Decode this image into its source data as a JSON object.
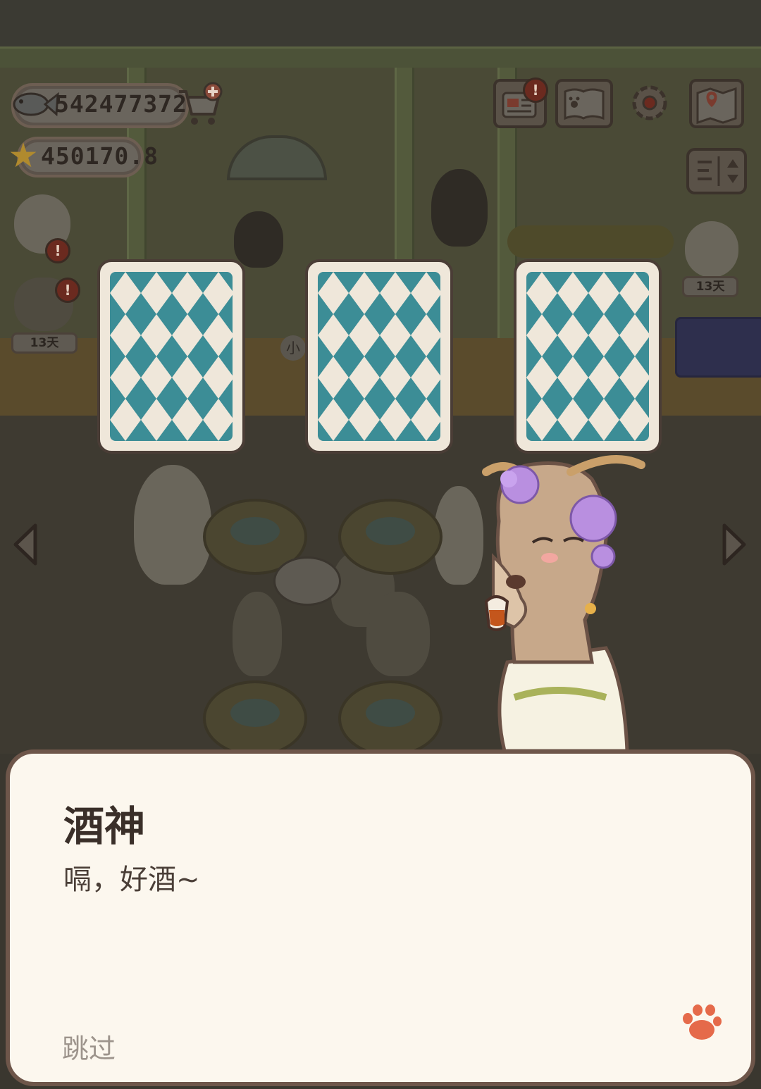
{
  "hud": {
    "fish_currency": "542477372",
    "star_currency": "450170.8",
    "add_currency_icon": "cart-plus-icon"
  },
  "top_buttons": [
    {
      "name": "mail-button",
      "icon": "card-notice-icon",
      "badge": "!"
    },
    {
      "name": "album-button",
      "icon": "paw-book-icon"
    },
    {
      "name": "settings-button",
      "icon": "gear-icon"
    },
    {
      "name": "map-button",
      "icon": "map-pin-icon"
    }
  ],
  "side": {
    "left_event_days": "13天",
    "right_event_days": "13天",
    "speech_fragment": "小"
  },
  "cards": [
    {
      "state": "face-down"
    },
    {
      "state": "face-down"
    },
    {
      "state": "face-down"
    }
  ],
  "dialog": {
    "speaker": "酒神",
    "line": "嗝，好酒~",
    "skip_label": "跳过",
    "advance_icon": "paw-icon"
  },
  "colors": {
    "card_teal": "#3c8d96",
    "card_cream": "#efe7da",
    "dialog_bg": "#fcf7ee",
    "dialog_border": "#6e564a",
    "paw_orange": "#e56a4a"
  }
}
